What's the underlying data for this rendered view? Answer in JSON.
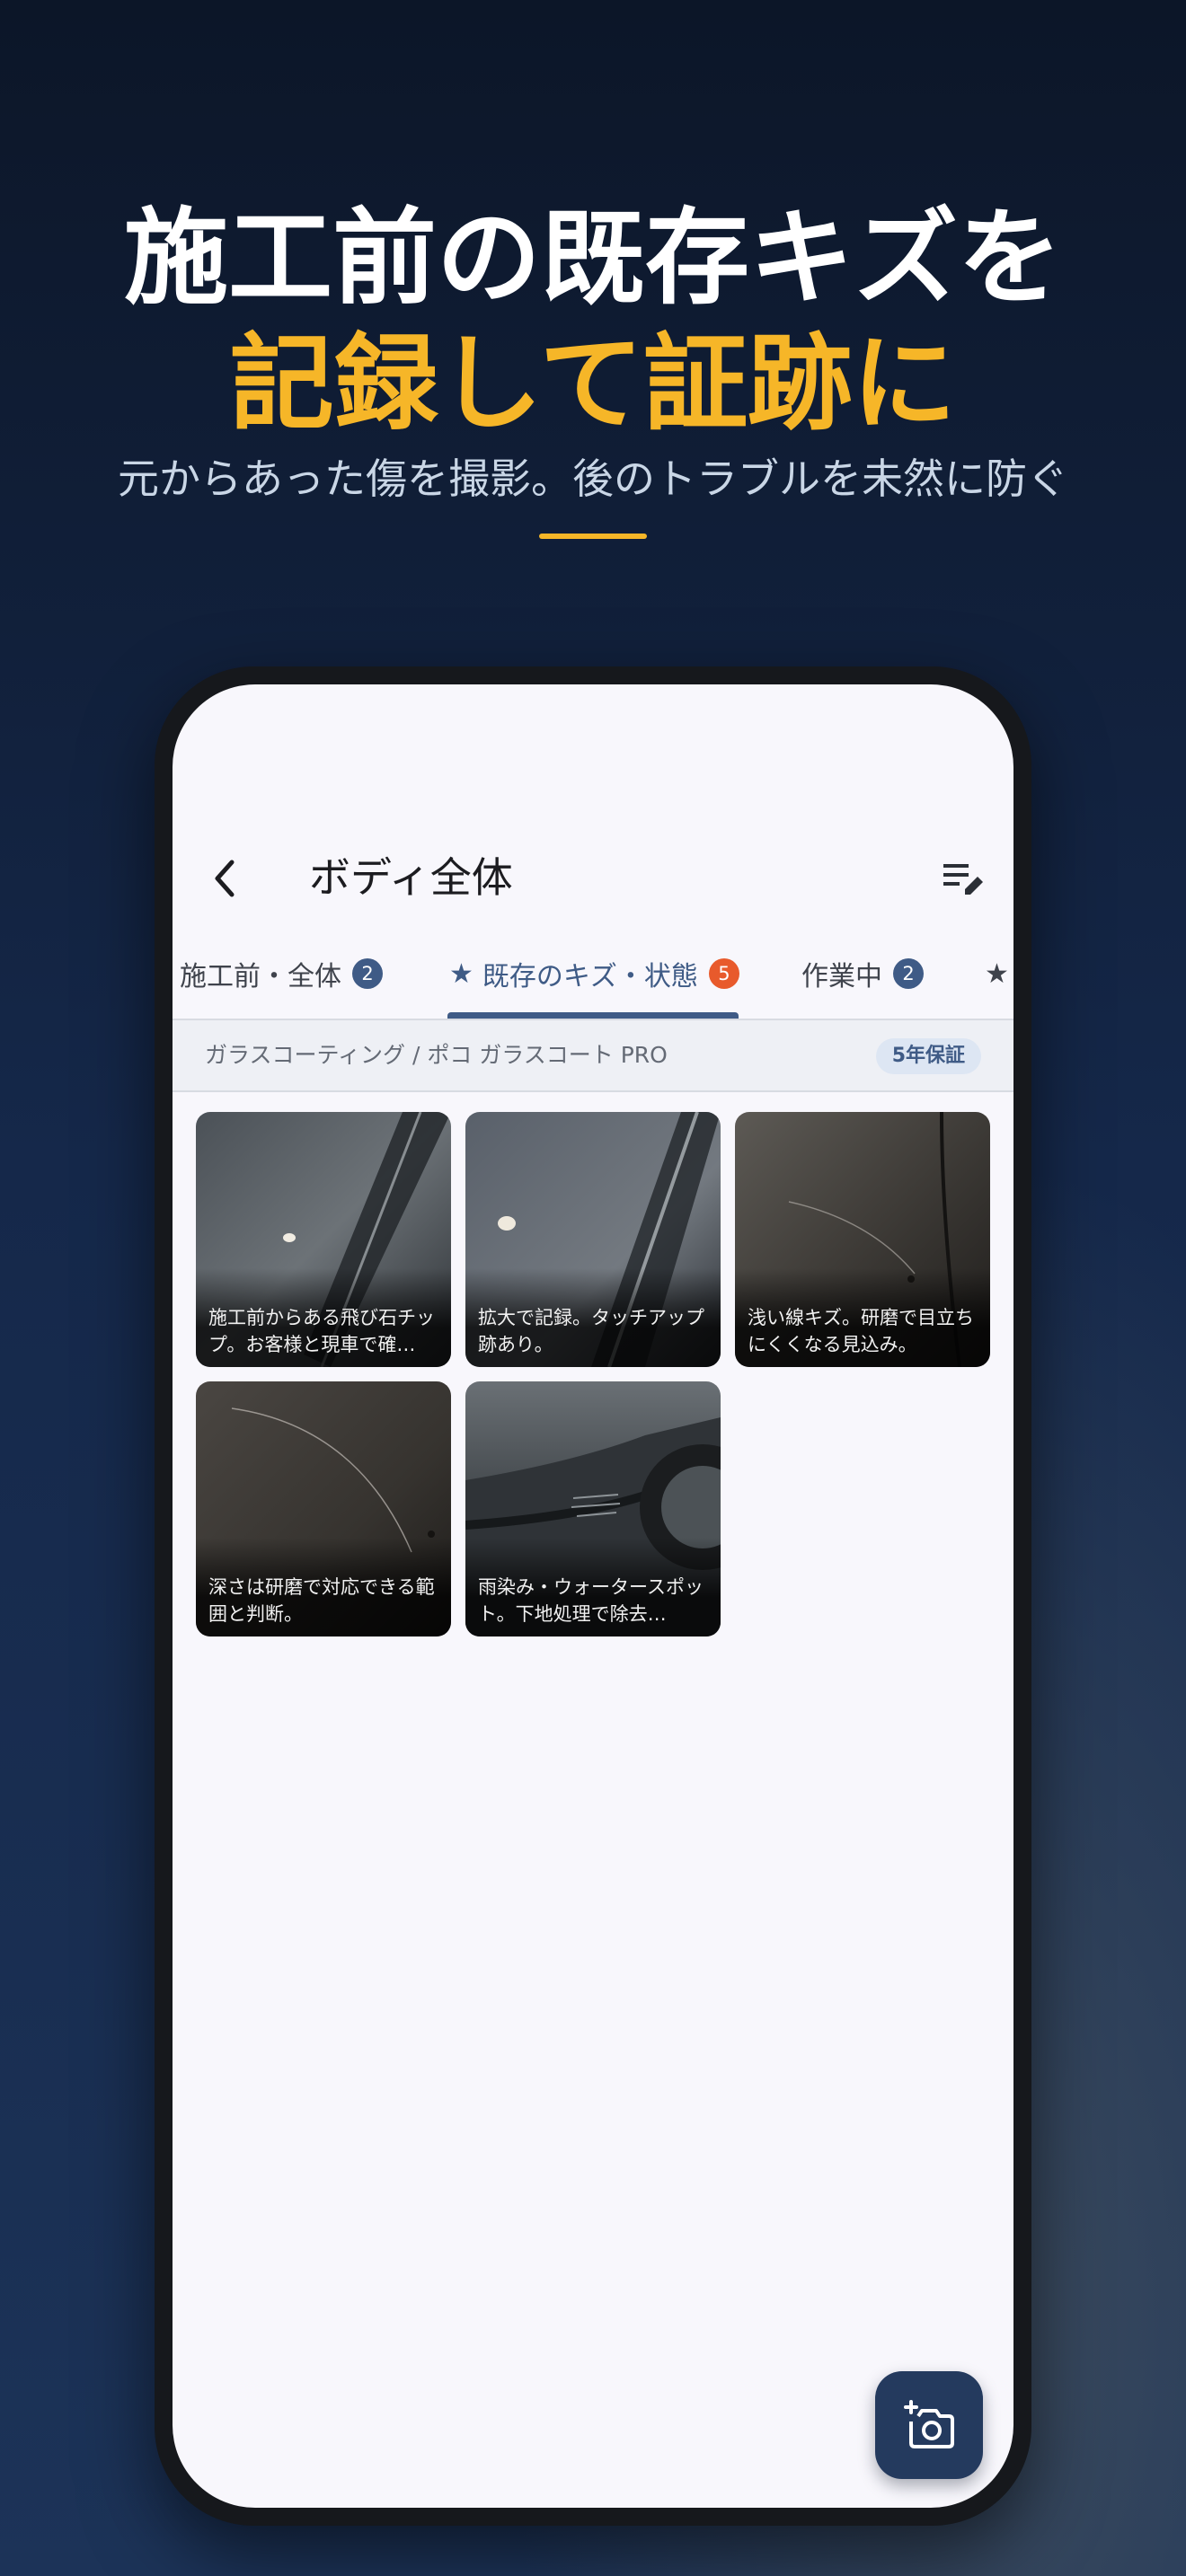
{
  "promo": {
    "headline_line1": "施工前の既存キズを",
    "headline_line2": "記録して証跡に",
    "subtitle": "元からあった傷を撮影。後のトラブルを未然に防ぐ",
    "accent_color": "#f6b628"
  },
  "app": {
    "back_icon": "back-chevron-icon",
    "title": "ボディ全体",
    "note_icon": "edit-note-icon",
    "tabs": [
      {
        "label": "施工前・全体",
        "badge": "2",
        "active": false
      },
      {
        "label": "既存のキズ・状態",
        "badge": "5",
        "active": true,
        "icon": "star-icon"
      },
      {
        "label": "作業中",
        "badge": "2",
        "active": false
      },
      {
        "label": "",
        "icon": "star-icon",
        "active": false
      }
    ],
    "coating": {
      "text": "ガラスコーティング / ポコ ガラスコート PRO",
      "warranty": "5年保証"
    },
    "photos": [
      {
        "caption": "施工前からある飛び石チップ。お客様と現車で確…"
      },
      {
        "caption": "拡大で記録。タッチアップ跡あり。"
      },
      {
        "caption": "浅い線キズ。研磨で目立ちにくくなる見込み。"
      },
      {
        "caption": "深さは研磨で対応できる範囲と判断。"
      },
      {
        "caption": "雨染み・ウォータースポット。下地処理で除去…"
      }
    ],
    "fab_icon": "add-photo-icon",
    "colors": {
      "primary": "#3f5b86",
      "badge_alert": "#e85a2c",
      "fab": "#243a5e"
    }
  }
}
